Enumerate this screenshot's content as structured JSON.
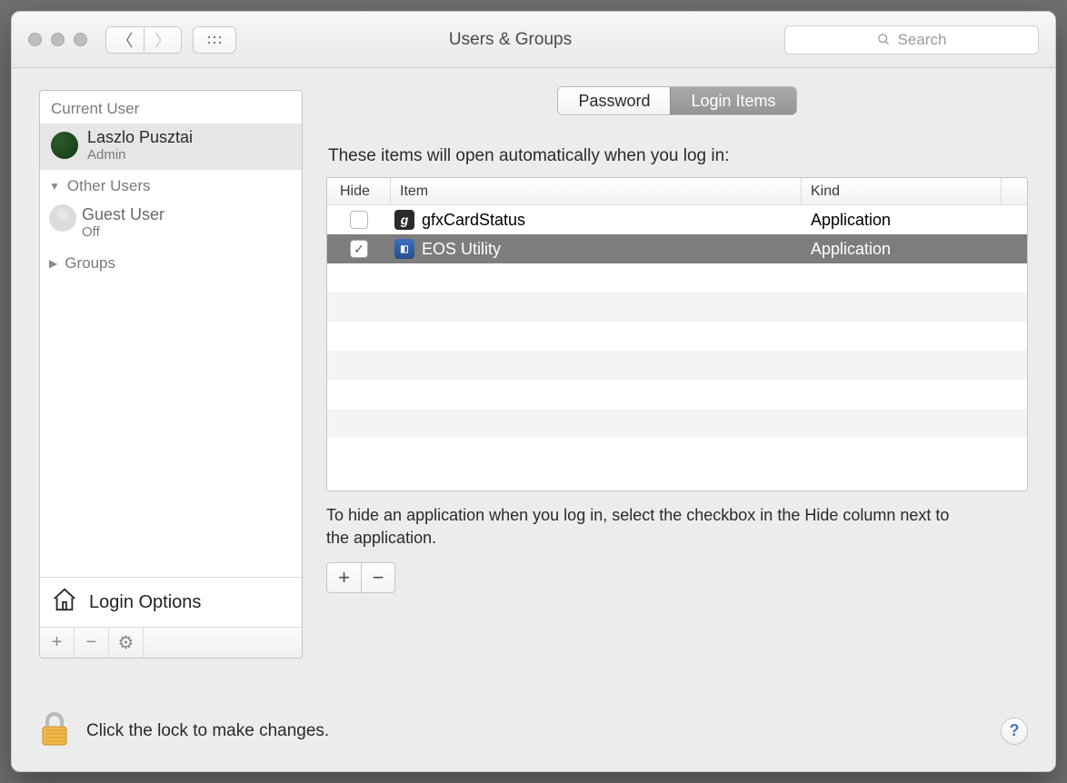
{
  "toolbar": {
    "title": "Users & Groups",
    "search_placeholder": "Search"
  },
  "sidebar": {
    "current_user_header": "Current User",
    "current_user": {
      "name": "Laszlo Pusztai",
      "role": "Admin"
    },
    "other_users_header": "Other Users",
    "guest": {
      "name": "Guest User",
      "status": "Off"
    },
    "groups_header": "Groups",
    "login_options_label": "Login Options"
  },
  "tabs": {
    "password": "Password",
    "login_items": "Login Items"
  },
  "main": {
    "subtitle": "These items will open automatically when you log in:",
    "columns": {
      "hide": "Hide",
      "item": "Item",
      "kind": "Kind"
    },
    "rows": [
      {
        "hide": false,
        "icon": "g",
        "name": "gfxCardStatus",
        "kind": "Application",
        "selected": false
      },
      {
        "hide": true,
        "icon": "📷",
        "name": "EOS Utility",
        "kind": "Application",
        "selected": true
      }
    ],
    "hint": "To hide an application when you log in, select the checkbox in the Hide column next to the application."
  },
  "lock": {
    "text": "Click the lock to make changes.",
    "help": "?"
  }
}
